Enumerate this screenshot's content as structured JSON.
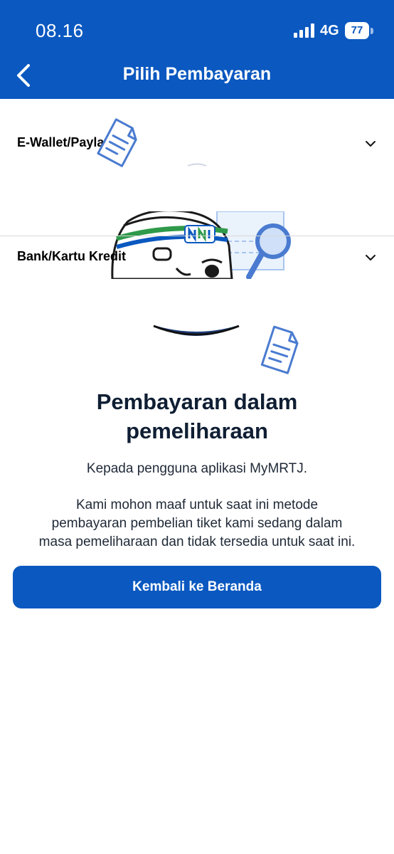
{
  "status_bar": {
    "time": "08.16",
    "network": "4G",
    "battery": "77",
    "icons": [
      "signal-bars-icon",
      "battery-icon"
    ]
  },
  "header": {
    "back_icon": "chevron-left-icon",
    "title": "Pilih Pembayaran"
  },
  "payment_sections": [
    {
      "label": "E-Wallet/Paylater",
      "icon": "chevron-down-icon"
    },
    {
      "label": "Bank/Kartu Kredit",
      "icon": "chevron-down-icon"
    }
  ],
  "maintenance": {
    "title_line1": "Pembayaran dalam",
    "title_line2": "pemeliharaan",
    "greeting": "Kepada pengguna aplikasi MyMRTJ.",
    "message_line1": "Kami mohon maaf untuk saat ini metode",
    "message_line2": "pembayaran pembelian tiket kami sedang dalam",
    "message_line3": "masa pemeliharaan dan tidak tersedia untuk saat ini.",
    "button_label": "Kembali ke Beranda"
  },
  "colors": {
    "brand_blue": "#0a58c0",
    "headband_green": "#2e9a4a",
    "text_dark": "#0f1e33"
  }
}
